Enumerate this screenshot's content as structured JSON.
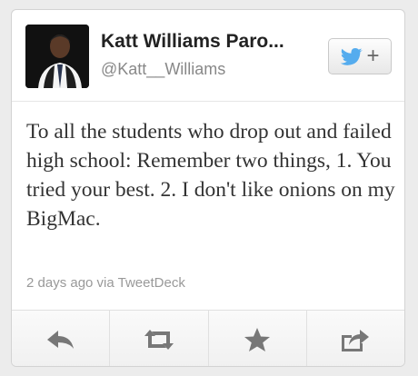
{
  "tweet": {
    "display_name": "Katt Williams Paro...",
    "handle": "@Katt__Williams",
    "text": "To all the students who drop out and failed high school: Remember two things, 1. You tried your best. 2. I don't like onions on my BigMac.",
    "meta": "2 days ago via TweetDeck"
  },
  "follow_button": {
    "icon": "twitter-bird-icon",
    "plus": "+"
  },
  "actions": [
    {
      "icon": "reply-icon"
    },
    {
      "icon": "retweet-icon"
    },
    {
      "icon": "star-icon"
    },
    {
      "icon": "share-icon"
    }
  ],
  "colors": {
    "bird": "#55acee",
    "action_icon": "#777777"
  }
}
